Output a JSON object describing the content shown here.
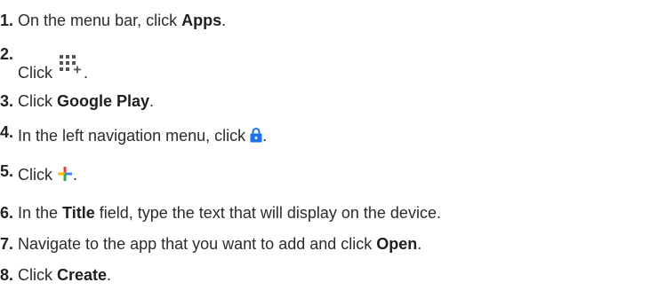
{
  "steps": [
    {
      "number": "1.",
      "before": "On the menu bar, click ",
      "bold": "Apps",
      "after": "."
    },
    {
      "number": "2.",
      "before": "Click ",
      "icon": "apps-grid-add-icon",
      "after": "."
    },
    {
      "number": "3.",
      "before": "Click ",
      "bold": "Google Play",
      "after": "."
    },
    {
      "number": "4.",
      "before": "In the left navigation menu, click ",
      "icon": "lock-icon",
      "after": "."
    },
    {
      "number": "5.",
      "before": "Click ",
      "icon": "multicolor-plus-icon",
      "after": "."
    },
    {
      "number": "6.",
      "before": "In the ",
      "bold": "Title",
      "after": " field, type the text that will display on the device."
    },
    {
      "number": "7.",
      "before": "Navigate to the app that you want to add and click ",
      "bold": "Open",
      "after": "."
    },
    {
      "number": "8.",
      "before": "Click ",
      "bold": "Create",
      "after": "."
    }
  ],
  "colors": {
    "lock_blue": "#1a73e8",
    "plus_red": "#ea4335",
    "plus_yellow": "#fbbc04",
    "plus_green": "#34a853",
    "plus_blue": "#4285f4",
    "grid_gray": "#555555"
  }
}
